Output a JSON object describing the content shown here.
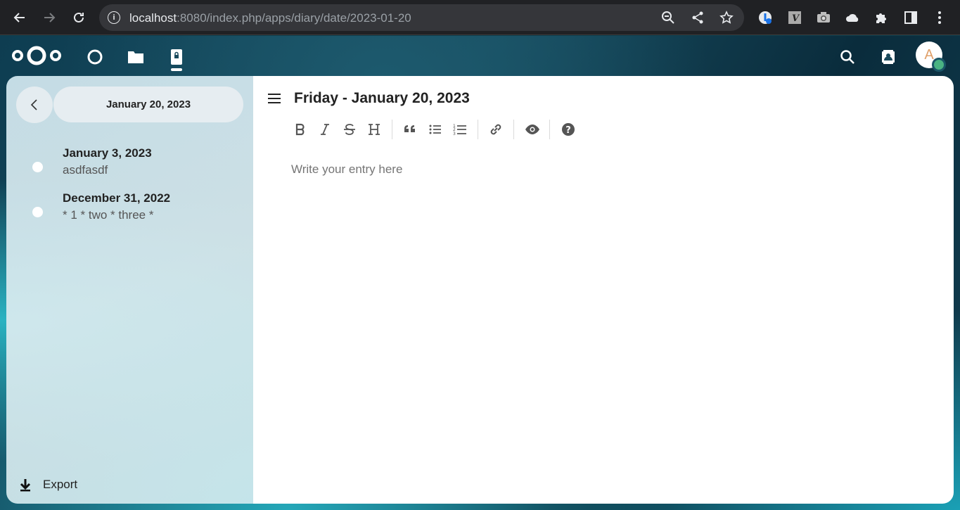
{
  "browser": {
    "url_host": "localhost",
    "url_rest": ":8080/index.php/apps/diary/date/2023-01-20",
    "extensions": [
      "password-manager-icon",
      "vimium-icon",
      "camera-icon",
      "cloud-icon",
      "puzzle-icon"
    ]
  },
  "header": {
    "avatar_letter": "A",
    "status_color": "#49b382",
    "apps": [
      "dashboard-icon",
      "files-icon",
      "diary-icon"
    ]
  },
  "sidebar": {
    "current_date": "January 20, 2023",
    "entries": [
      {
        "title": "January 3, 2023",
        "excerpt": "asdfasdf"
      },
      {
        "title": "December 31, 2022",
        "excerpt": "* 1 * two * three *"
      }
    ],
    "export_label": "Export"
  },
  "main": {
    "title": "Friday - January 20, 2023",
    "editor_placeholder": "Write your entry here",
    "toolbar": [
      "bold",
      "italic",
      "strikethrough",
      "heading",
      "quote",
      "unordered-list",
      "ordered-list",
      "link",
      "preview",
      "help"
    ]
  }
}
